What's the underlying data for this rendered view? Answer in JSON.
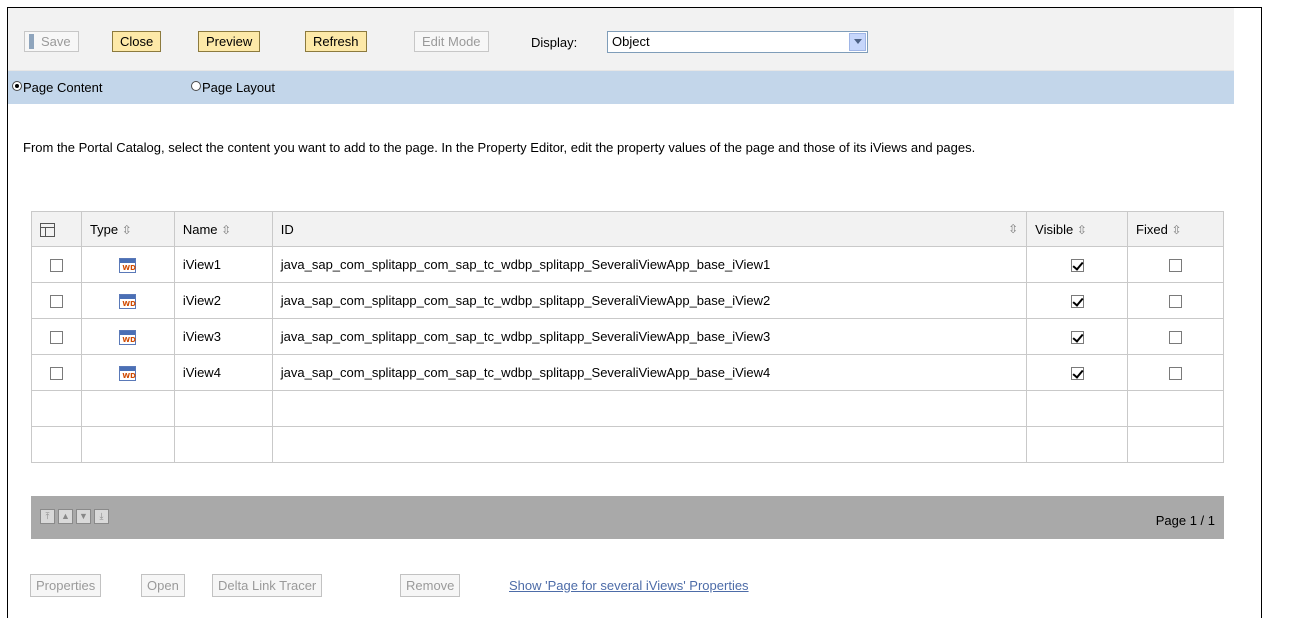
{
  "toolbar": {
    "save": "Save",
    "close": "Close",
    "preview": "Preview",
    "refresh": "Refresh",
    "edit_mode": "Edit Mode",
    "display_label": "Display:",
    "display_value": "Object"
  },
  "modes": {
    "page_content": "Page Content",
    "page_layout": "Page Layout",
    "selected": "page_content"
  },
  "description": "From the Portal Catalog, select the content you want to add to the page. In the Property Editor, edit the property values of the page and those of its iViews and pages.",
  "table": {
    "columns": [
      "Type",
      "Name",
      "ID",
      "Visible",
      "Fixed"
    ],
    "rows": [
      {
        "type_icon": "wd-icon",
        "name": "iView1",
        "id": "java_sap_com_splitapp_com_sap_tc_wdbp_splitapp_SeveraliViewApp_base_iView1",
        "visible": true,
        "fixed": false
      },
      {
        "type_icon": "wd-icon",
        "name": "iView2",
        "id": "java_sap_com_splitapp_com_sap_tc_wdbp_splitapp_SeveraliViewApp_base_iView2",
        "visible": true,
        "fixed": false
      },
      {
        "type_icon": "wd-icon",
        "name": "iView3",
        "id": "java_sap_com_splitapp_com_sap_tc_wdbp_splitapp_SeveraliViewApp_base_iView3",
        "visible": true,
        "fixed": false
      },
      {
        "type_icon": "wd-icon",
        "name": "iView4",
        "id": "java_sap_com_splitapp_com_sap_tc_wdbp_splitapp_SeveraliViewApp_base_iView4",
        "visible": true,
        "fixed": false
      }
    ],
    "type_icon_text": "WD",
    "page_info": "Page 1 / 1"
  },
  "actions": {
    "properties": "Properties",
    "open": "Open",
    "delta_link_tracer": "Delta Link Tracer",
    "remove": "Remove",
    "show_link": "Show 'Page for several iViews' Properties"
  }
}
